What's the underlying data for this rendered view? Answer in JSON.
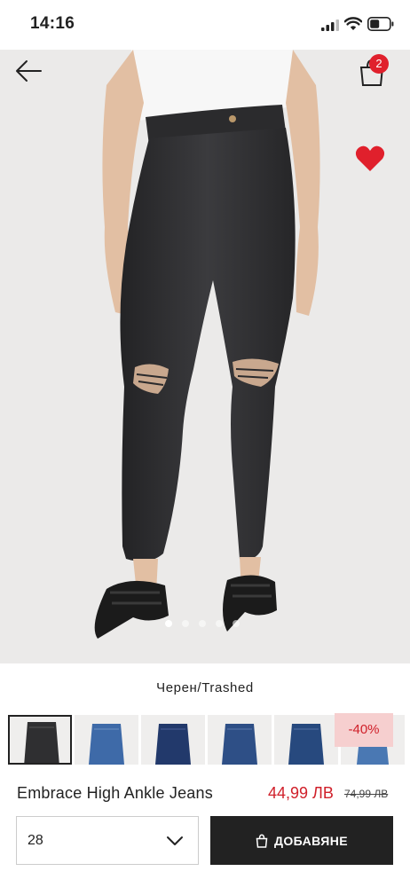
{
  "status_bar": {
    "time": "14:16"
  },
  "header": {
    "cart_count": "2"
  },
  "product": {
    "color_label": "Черен/Trashed",
    "name": "Embrace High Ankle Jeans",
    "price_current": "44,99 ЛВ",
    "price_old": "74,99 ЛВ",
    "discount": "-40%"
  },
  "carousel": {
    "total": 5,
    "active_index": 0
  },
  "swatches": [
    {
      "shade": "#2f2f31",
      "selected": true
    },
    {
      "shade": "#3e6aa8",
      "selected": false
    },
    {
      "shade": "#22396b",
      "selected": false
    },
    {
      "shade": "#2e4f86",
      "selected": false
    },
    {
      "shade": "#27497e",
      "selected": false
    },
    {
      "shade": "#4a78b3",
      "selected": false
    }
  ],
  "size_select": {
    "value": "28"
  },
  "add_button": {
    "label": "ДОБАВЯНЕ"
  },
  "colors": {
    "accent_red": "#e0202c",
    "price_red": "#d0202a",
    "button_dark": "#222222"
  },
  "icons": [
    "back-arrow-icon",
    "shopping-bag-icon",
    "heart-icon",
    "chevron-down-icon",
    "bag-small-icon",
    "signal-icon",
    "wifi-icon",
    "battery-icon"
  ]
}
